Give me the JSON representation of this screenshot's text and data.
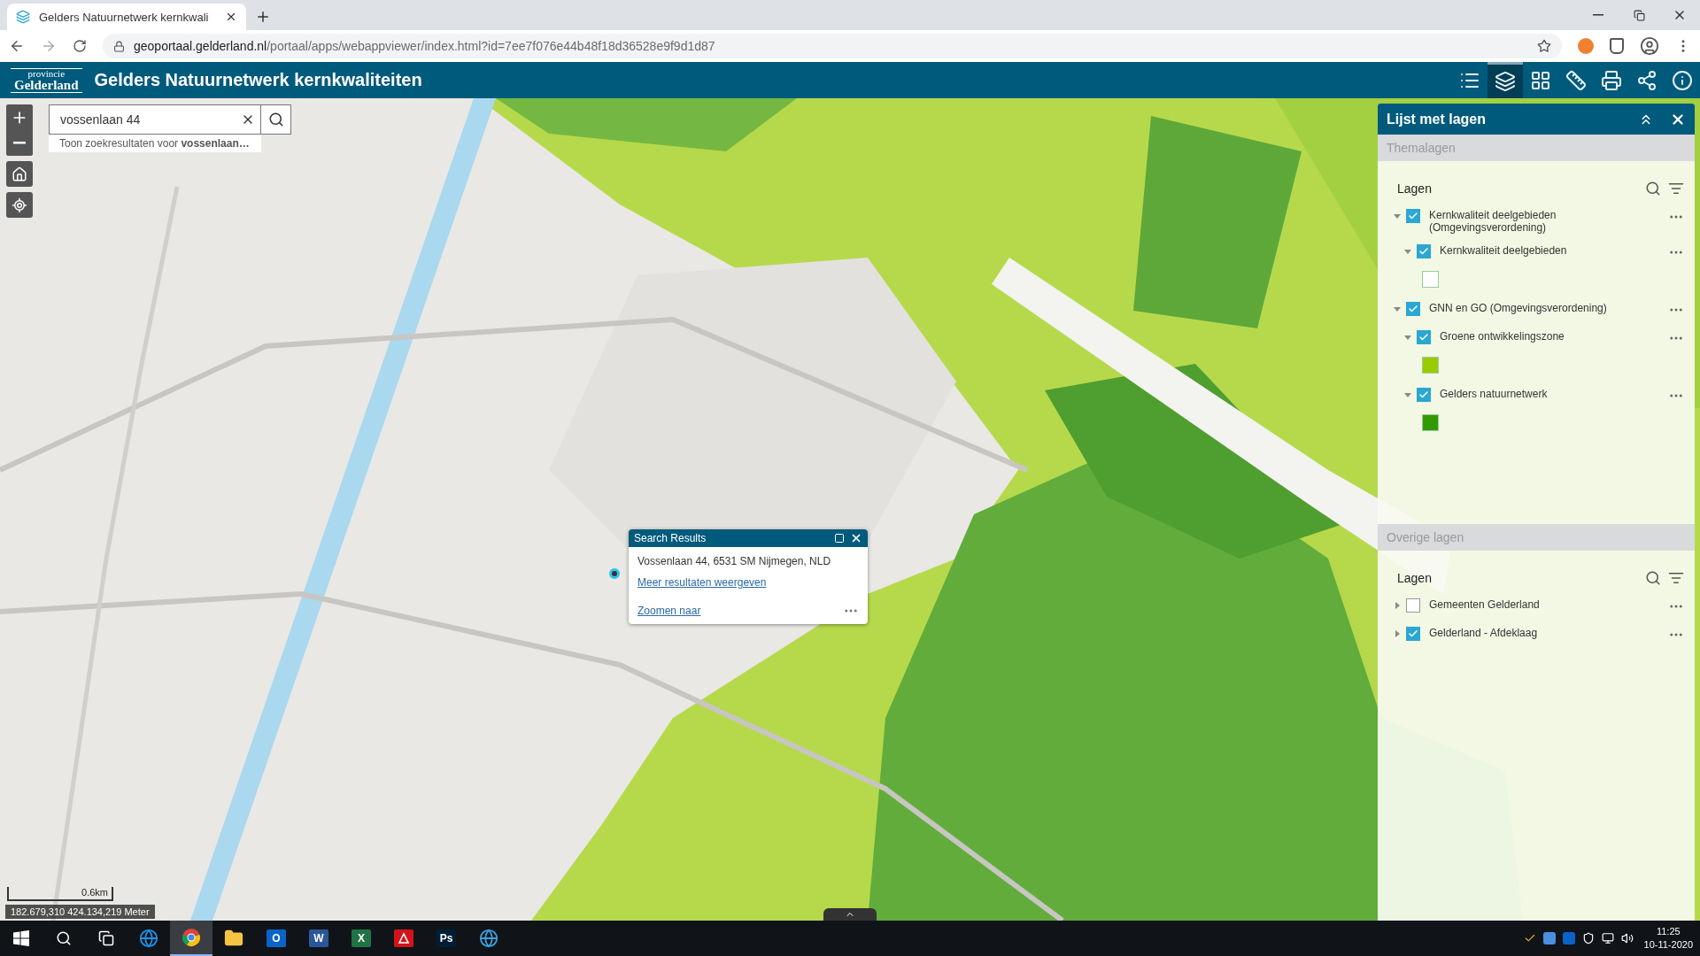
{
  "browser": {
    "tab_title": "Gelders Natuurnetwerk kernkwali",
    "url_host": "geoportaal.gelderland.nl",
    "url_path": "/portaal/apps/webappviewer/index.html?id=7ee7f076e44b48f18d36528e9f9d1d87"
  },
  "header": {
    "logo_top": "provincie",
    "logo_bottom": "Gelderland",
    "title": "Gelders Natuurnetwerk kernkwaliteiten",
    "tools": [
      {
        "kind": "legend",
        "selected": false
      },
      {
        "kind": "layers",
        "selected": true
      },
      {
        "kind": "basemap",
        "selected": false
      },
      {
        "kind": "measure",
        "selected": false
      },
      {
        "kind": "print",
        "selected": false
      },
      {
        "kind": "share",
        "selected": false
      },
      {
        "kind": "about",
        "selected": false
      }
    ]
  },
  "search": {
    "value": "vossenlaan 44",
    "suggestion": "Toon zoekresultaten voor **vossenlaan…**"
  },
  "popup": {
    "title": "Search Results",
    "address": "Vossenlaan 44, 6531 SM Nijmegen, NLD",
    "more_link": "Meer resultaten weergeven",
    "zoom_link": "Zoomen naar"
  },
  "layer_panel": {
    "title": "Lijst met lagen",
    "sections": [
      {
        "heading": "Themalagen",
        "label": "Lagen",
        "layers": [
          {
            "label": "Kernkwaliteit deelgebieden (Omgevingsverordening)",
            "checked": true,
            "expanded": true,
            "children": [
              {
                "label": "Kernkwaliteit deelgebieden",
                "checked": true,
                "expanded": true,
                "legend": [
                  {
                    "color": "#ffffff"
                  }
                ]
              }
            ]
          },
          {
            "label": "GNN en GO (Omgevingsverordening)",
            "checked": true,
            "expanded": true,
            "children": [
              {
                "label": "Groene ontwikkelingszone",
                "checked": true,
                "expanded": true,
                "legend": [
                  {
                    "color": "#99cc00"
                  }
                ]
              },
              {
                "label": "Gelders natuurnetwerk",
                "checked": true,
                "expanded": true,
                "legend": [
                  {
                    "color": "#339900"
                  }
                ]
              }
            ]
          }
        ]
      },
      {
        "heading": "Overige lagen",
        "label": "Lagen",
        "layers": [
          {
            "label": "Gemeenten Gelderland",
            "checked": false,
            "expanded": false
          },
          {
            "label": "Gelderland - Afdeklaag",
            "checked": true,
            "expanded": false
          }
        ]
      }
    ]
  },
  "status": {
    "scale": "0.6km",
    "coords": "182.679,310 424.134,219 Meter"
  },
  "taskbar": {
    "apps": [
      {
        "kind": "search",
        "selected": false
      },
      {
        "kind": "taskview",
        "selected": false
      },
      {
        "kind": "edge",
        "selected": false
      },
      {
        "kind": "chrome",
        "selected": true
      },
      {
        "kind": "explorer",
        "selected": false
      },
      {
        "kind": "outlook",
        "selected": false,
        "glyph": "O"
      },
      {
        "kind": "word",
        "selected": false,
        "glyph": "W"
      },
      {
        "kind": "excel",
        "selected": false,
        "glyph": "X"
      },
      {
        "kind": "acrobat",
        "selected": false
      },
      {
        "kind": "photoshop",
        "selected": false,
        "glyph": "Ps"
      },
      {
        "kind": "globe",
        "selected": false
      }
    ],
    "time": "11:25",
    "date": "10-11-2020"
  }
}
